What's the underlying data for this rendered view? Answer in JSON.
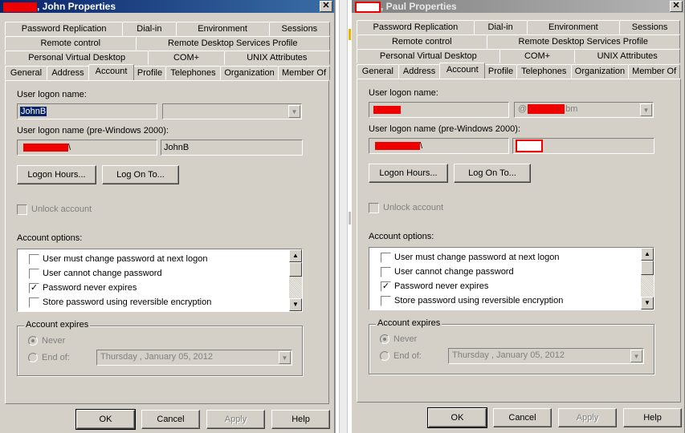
{
  "dialogs": [
    {
      "title": ", John Properties",
      "close_glyph": "✕",
      "tabs_row1": [
        "Password Replication",
        "Dial-in",
        "Environment",
        "Sessions"
      ],
      "tabs_row2": [
        "Remote control",
        "Remote Desktop Services Profile"
      ],
      "tabs_row3": [
        "Personal Virtual Desktop",
        "COM+",
        "UNIX Attributes"
      ],
      "tabs_row4": [
        "General",
        "Address",
        "Account",
        "Profile",
        "Telephones",
        "Organization",
        "Member Of"
      ],
      "active_tab": "Account",
      "logon_label": "User logon name:",
      "logon_value": "JohnB",
      "domain_value": "",
      "pre2000_label": "User logon name (pre-Windows 2000):",
      "pre2000_domain_suffix": "\\",
      "pre2000_user": "JohnB",
      "logon_hours_btn": "Logon Hours...",
      "log_on_to_btn": "Log On To...",
      "unlock_label": "Unlock account",
      "account_options_label": "Account options:",
      "options": [
        {
          "label": "User must change password at next logon",
          "checked": false
        },
        {
          "label": "User cannot change password",
          "checked": false
        },
        {
          "label": "Password never expires",
          "checked": true
        },
        {
          "label": "Store password using reversible encryption",
          "checked": false
        }
      ],
      "expires_title": "Account expires",
      "never_label": "Never",
      "endof_label": "End of:",
      "endof_date": "Thursday  ,   January   05, 2012",
      "buttons": {
        "ok": "OK",
        "cancel": "Cancel",
        "apply": "Apply",
        "help": "Help"
      }
    },
    {
      "title": ", Paul Properties",
      "close_glyph": "✕",
      "tabs_row1": [
        "Password Replication",
        "Dial-in",
        "Environment",
        "Sessions"
      ],
      "tabs_row2": [
        "Remote control",
        "Remote Desktop Services Profile"
      ],
      "tabs_row3": [
        "Personal Virtual Desktop",
        "COM+",
        "UNIX Attributes"
      ],
      "tabs_row4": [
        "General",
        "Address",
        "Account",
        "Profile",
        "Telephones",
        "Organization",
        "Member Of"
      ],
      "active_tab": "Account",
      "logon_label": "User logon name:",
      "logon_value": "",
      "domain_prefix": "@",
      "domain_suffix": "bm",
      "pre2000_label": "User logon name (pre-Windows 2000):",
      "pre2000_domain_suffix": "\\",
      "pre2000_user": "",
      "logon_hours_btn": "Logon Hours...",
      "log_on_to_btn": "Log On To...",
      "unlock_label": "Unlock account",
      "account_options_label": "Account options:",
      "options": [
        {
          "label": "User must change password at next logon",
          "checked": false
        },
        {
          "label": "User cannot change password",
          "checked": false
        },
        {
          "label": "Password never expires",
          "checked": true
        },
        {
          "label": "Store password using reversible encryption",
          "checked": false
        }
      ],
      "expires_title": "Account expires",
      "never_label": "Never",
      "endof_label": "End of:",
      "endof_date": "Thursday  ,   January   05, 2012",
      "buttons": {
        "ok": "OK",
        "cancel": "Cancel",
        "apply": "Apply",
        "help": "Help"
      }
    }
  ],
  "glyphs": {
    "check": "✓",
    "arrow_down": "▼",
    "arrow_up": "▲"
  }
}
